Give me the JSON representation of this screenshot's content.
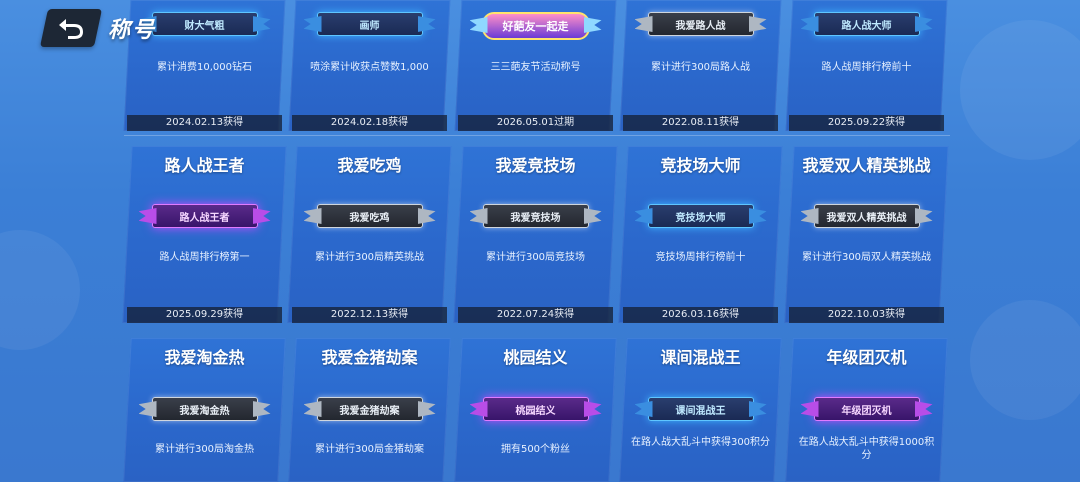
{
  "header": {
    "title": "称号"
  },
  "rows": [
    {
      "cards": [
        {
          "name": "",
          "badge": "财大气粗",
          "badge_style": "blue",
          "desc": "累计消费10,000钻石",
          "date": "2024.02.13获得"
        },
        {
          "name": "",
          "badge": "画师",
          "badge_style": "blue",
          "desc": "喷涂累计收获点赞数1,000",
          "date": "2024.02.18获得"
        },
        {
          "name": "",
          "badge": "好葩友一起走",
          "badge_style": "event",
          "desc": "三三葩友节活动称号",
          "date": "2026.05.01过期"
        },
        {
          "name": "",
          "badge": "我爱路人战",
          "badge_style": "gray",
          "desc": "累计进行300局路人战",
          "date": "2022.08.11获得"
        },
        {
          "name": "",
          "badge": "路人战大师",
          "badge_style": "blue",
          "desc": "路人战周排行榜前十",
          "date": "2025.09.22获得"
        }
      ]
    },
    {
      "cards": [
        {
          "name": "路人战王者",
          "badge": "路人战王者",
          "badge_style": "purple",
          "desc": "路人战周排行榜第一",
          "date": "2025.09.29获得"
        },
        {
          "name": "我爱吃鸡",
          "badge": "我爱吃鸡",
          "badge_style": "gray",
          "desc": "累计进行300局精英挑战",
          "date": "2022.12.13获得"
        },
        {
          "name": "我爱竞技场",
          "badge": "我爱竞技场",
          "badge_style": "gray",
          "desc": "累计进行300局竞技场",
          "date": "2022.07.24获得"
        },
        {
          "name": "竞技场大师",
          "badge": "竞技场大师",
          "badge_style": "blue",
          "desc": "竞技场周排行榜前十",
          "date": "2026.03.16获得"
        },
        {
          "name": "我爱双人精英挑战",
          "badge": "我爱双人精英挑战",
          "badge_style": "gray",
          "desc": "累计进行300局双人精英挑战",
          "date": "2022.10.03获得"
        }
      ]
    },
    {
      "cards": [
        {
          "name": "我爱淘金热",
          "badge": "我爱淘金热",
          "badge_style": "gray",
          "desc": "累计进行300局淘金热",
          "date": ""
        },
        {
          "name": "我爱金猪劫案",
          "badge": "我爱金猪劫案",
          "badge_style": "gray",
          "desc": "累计进行300局金猪劫案",
          "date": ""
        },
        {
          "name": "桃园结义",
          "badge": "桃园结义",
          "badge_style": "purple",
          "desc": "拥有500个粉丝",
          "date": ""
        },
        {
          "name": "课间混战王",
          "badge": "课间混战王",
          "badge_style": "blue",
          "desc": "在路人战大乱斗中获得300积分",
          "date": ""
        },
        {
          "name": "年级团灭机",
          "badge": "年级团灭机",
          "badge_style": "purple",
          "desc": "在路人战大乱斗中获得1000积分",
          "date": ""
        }
      ]
    }
  ]
}
